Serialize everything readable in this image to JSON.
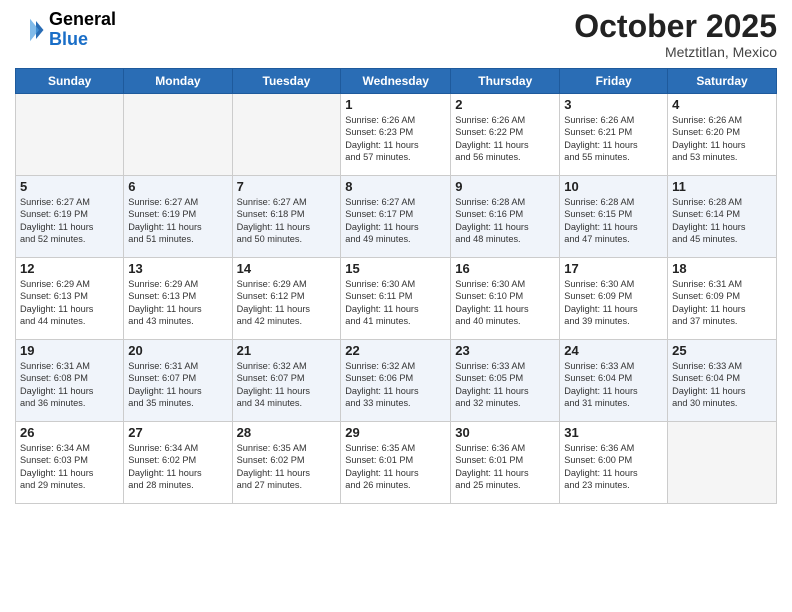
{
  "header": {
    "logo_line1": "General",
    "logo_line2": "Blue",
    "month": "October 2025",
    "location": "Metztitlan, Mexico"
  },
  "days_of_week": [
    "Sunday",
    "Monday",
    "Tuesday",
    "Wednesday",
    "Thursday",
    "Friday",
    "Saturday"
  ],
  "weeks": [
    [
      {
        "num": "",
        "info": ""
      },
      {
        "num": "",
        "info": ""
      },
      {
        "num": "",
        "info": ""
      },
      {
        "num": "1",
        "info": "Sunrise: 6:26 AM\nSunset: 6:23 PM\nDaylight: 11 hours\nand 57 minutes."
      },
      {
        "num": "2",
        "info": "Sunrise: 6:26 AM\nSunset: 6:22 PM\nDaylight: 11 hours\nand 56 minutes."
      },
      {
        "num": "3",
        "info": "Sunrise: 6:26 AM\nSunset: 6:21 PM\nDaylight: 11 hours\nand 55 minutes."
      },
      {
        "num": "4",
        "info": "Sunrise: 6:26 AM\nSunset: 6:20 PM\nDaylight: 11 hours\nand 53 minutes."
      }
    ],
    [
      {
        "num": "5",
        "info": "Sunrise: 6:27 AM\nSunset: 6:19 PM\nDaylight: 11 hours\nand 52 minutes."
      },
      {
        "num": "6",
        "info": "Sunrise: 6:27 AM\nSunset: 6:19 PM\nDaylight: 11 hours\nand 51 minutes."
      },
      {
        "num": "7",
        "info": "Sunrise: 6:27 AM\nSunset: 6:18 PM\nDaylight: 11 hours\nand 50 minutes."
      },
      {
        "num": "8",
        "info": "Sunrise: 6:27 AM\nSunset: 6:17 PM\nDaylight: 11 hours\nand 49 minutes."
      },
      {
        "num": "9",
        "info": "Sunrise: 6:28 AM\nSunset: 6:16 PM\nDaylight: 11 hours\nand 48 minutes."
      },
      {
        "num": "10",
        "info": "Sunrise: 6:28 AM\nSunset: 6:15 PM\nDaylight: 11 hours\nand 47 minutes."
      },
      {
        "num": "11",
        "info": "Sunrise: 6:28 AM\nSunset: 6:14 PM\nDaylight: 11 hours\nand 45 minutes."
      }
    ],
    [
      {
        "num": "12",
        "info": "Sunrise: 6:29 AM\nSunset: 6:13 PM\nDaylight: 11 hours\nand 44 minutes."
      },
      {
        "num": "13",
        "info": "Sunrise: 6:29 AM\nSunset: 6:13 PM\nDaylight: 11 hours\nand 43 minutes."
      },
      {
        "num": "14",
        "info": "Sunrise: 6:29 AM\nSunset: 6:12 PM\nDaylight: 11 hours\nand 42 minutes."
      },
      {
        "num": "15",
        "info": "Sunrise: 6:30 AM\nSunset: 6:11 PM\nDaylight: 11 hours\nand 41 minutes."
      },
      {
        "num": "16",
        "info": "Sunrise: 6:30 AM\nSunset: 6:10 PM\nDaylight: 11 hours\nand 40 minutes."
      },
      {
        "num": "17",
        "info": "Sunrise: 6:30 AM\nSunset: 6:09 PM\nDaylight: 11 hours\nand 39 minutes."
      },
      {
        "num": "18",
        "info": "Sunrise: 6:31 AM\nSunset: 6:09 PM\nDaylight: 11 hours\nand 37 minutes."
      }
    ],
    [
      {
        "num": "19",
        "info": "Sunrise: 6:31 AM\nSunset: 6:08 PM\nDaylight: 11 hours\nand 36 minutes."
      },
      {
        "num": "20",
        "info": "Sunrise: 6:31 AM\nSunset: 6:07 PM\nDaylight: 11 hours\nand 35 minutes."
      },
      {
        "num": "21",
        "info": "Sunrise: 6:32 AM\nSunset: 6:07 PM\nDaylight: 11 hours\nand 34 minutes."
      },
      {
        "num": "22",
        "info": "Sunrise: 6:32 AM\nSunset: 6:06 PM\nDaylight: 11 hours\nand 33 minutes."
      },
      {
        "num": "23",
        "info": "Sunrise: 6:33 AM\nSunset: 6:05 PM\nDaylight: 11 hours\nand 32 minutes."
      },
      {
        "num": "24",
        "info": "Sunrise: 6:33 AM\nSunset: 6:04 PM\nDaylight: 11 hours\nand 31 minutes."
      },
      {
        "num": "25",
        "info": "Sunrise: 6:33 AM\nSunset: 6:04 PM\nDaylight: 11 hours\nand 30 minutes."
      }
    ],
    [
      {
        "num": "26",
        "info": "Sunrise: 6:34 AM\nSunset: 6:03 PM\nDaylight: 11 hours\nand 29 minutes."
      },
      {
        "num": "27",
        "info": "Sunrise: 6:34 AM\nSunset: 6:02 PM\nDaylight: 11 hours\nand 28 minutes."
      },
      {
        "num": "28",
        "info": "Sunrise: 6:35 AM\nSunset: 6:02 PM\nDaylight: 11 hours\nand 27 minutes."
      },
      {
        "num": "29",
        "info": "Sunrise: 6:35 AM\nSunset: 6:01 PM\nDaylight: 11 hours\nand 26 minutes."
      },
      {
        "num": "30",
        "info": "Sunrise: 6:36 AM\nSunset: 6:01 PM\nDaylight: 11 hours\nand 25 minutes."
      },
      {
        "num": "31",
        "info": "Sunrise: 6:36 AM\nSunset: 6:00 PM\nDaylight: 11 hours\nand 23 minutes."
      },
      {
        "num": "",
        "info": ""
      }
    ]
  ]
}
